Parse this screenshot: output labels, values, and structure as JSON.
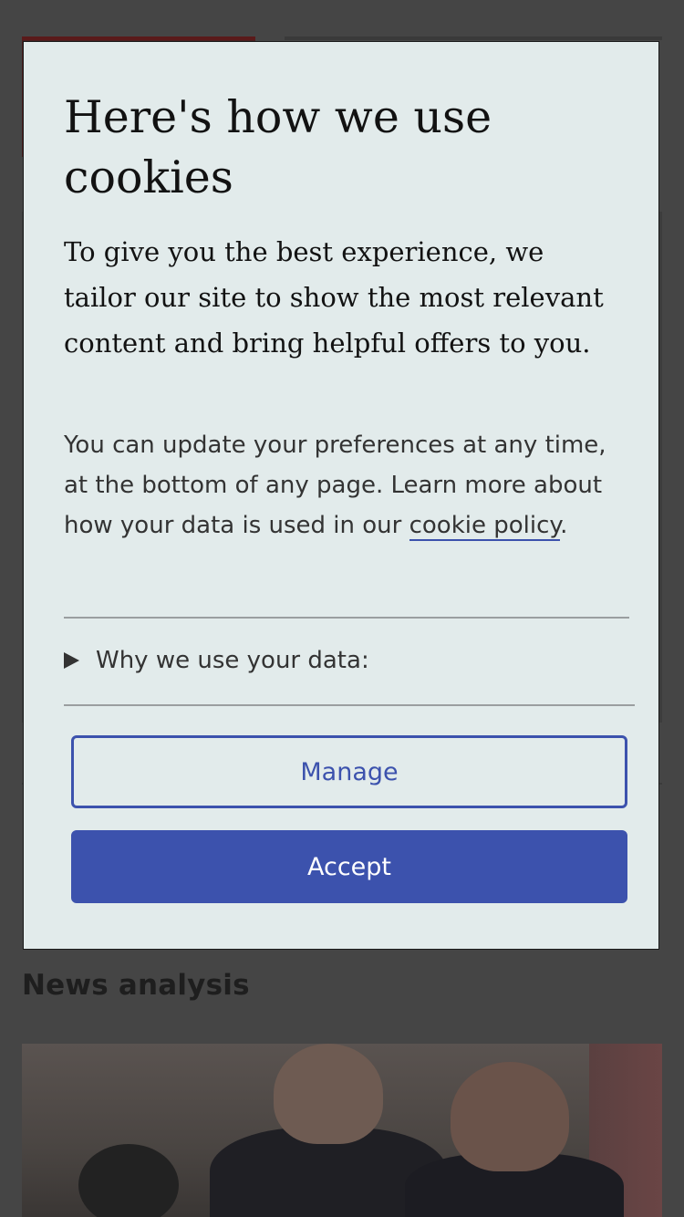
{
  "background": {
    "section_title": "News analysis"
  },
  "cookie_dialog": {
    "title": "Here's how we use cookies",
    "lead": "To give you the best experience, we tailor our site to show the most relevant content and bring helpful offers to you.",
    "body_before_link": "You can update your preferences at any time, at the bottom of any page. Learn more about how your data is used in our ",
    "link_text": "cookie policy",
    "body_after_link": ".",
    "disclosure_label": "Why we use your data:",
    "manage_label": "Manage",
    "accept_label": "Accept"
  },
  "colors": {
    "accent": "#3c52ad",
    "dialog_background": "#e2ebeb",
    "overlay": "#454545"
  },
  "icons": {
    "disclosure": "triangle-right-icon"
  }
}
